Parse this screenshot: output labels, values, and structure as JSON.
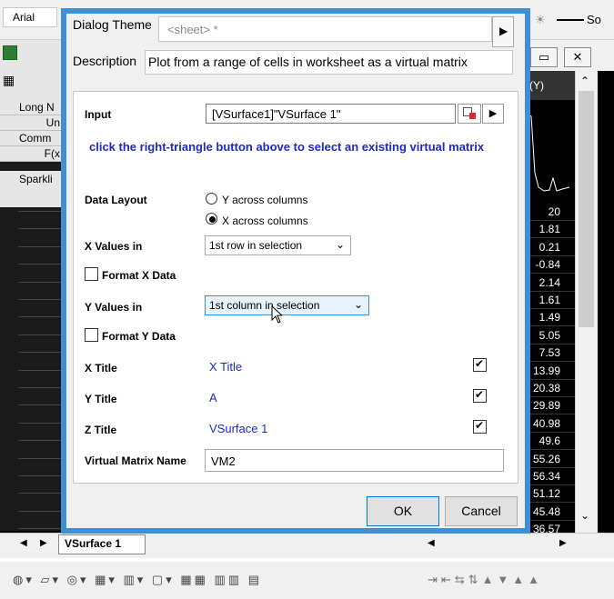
{
  "app": {
    "font_name": "Arial",
    "so_label": "So",
    "row_headers": [
      "Long N",
      "Un",
      "Comm",
      "F(x"
    ],
    "sparkline_label": "Sparkli",
    "col_header": "(Y)",
    "column_values": [
      "20",
      "1.81",
      "0.21",
      "-0.84",
      "2.14",
      "1.61",
      "1.49",
      "5.05",
      "7.53",
      "13.99",
      "20.38",
      "29.89",
      "40.98",
      "49.6",
      "55.26",
      "56.34",
      "51.12",
      "45.48",
      "36.57"
    ],
    "sheet_tab": "VSurface 1"
  },
  "dialog": {
    "theme_label": "Dialog Theme",
    "theme_value": "<sheet> *",
    "description_label": "Description",
    "description_value": "Plot from a range of cells in worksheet as a virtual matrix",
    "input_label": "Input",
    "input_value": "[VSurface1]\"VSurface 1\"",
    "hint": "click the right-triangle button above to select an existing virtual matrix",
    "data_layout_label": "Data Layout",
    "layout_options": [
      "Y across columns",
      "X across columns"
    ],
    "layout_selected": "X across columns",
    "x_values_label": "X Values in",
    "x_values_selected": "1st row in selection",
    "format_x_label": "Format X Data",
    "y_values_label": "Y Values in",
    "y_values_selected": "1st column in selection",
    "format_y_label": "Format Y Data",
    "x_title_label": "X Title",
    "x_title_value": "X Title",
    "y_title_label": "Y Title",
    "y_title_value": "A",
    "z_title_label": "Z Title",
    "z_title_value": "VSurface 1",
    "vm_name_label": "Virtual Matrix Name",
    "vm_name_value": "VM2",
    "ok_label": "OK",
    "cancel_label": "Cancel",
    "x_title_checked": true,
    "y_title_checked": true,
    "z_title_checked": true,
    "format_x_checked": false,
    "format_y_checked": false
  },
  "colors": {
    "dialog_border": "#3d8fd6",
    "hint_text": "#1c2ac2",
    "value_text": "#1c2ac2"
  }
}
